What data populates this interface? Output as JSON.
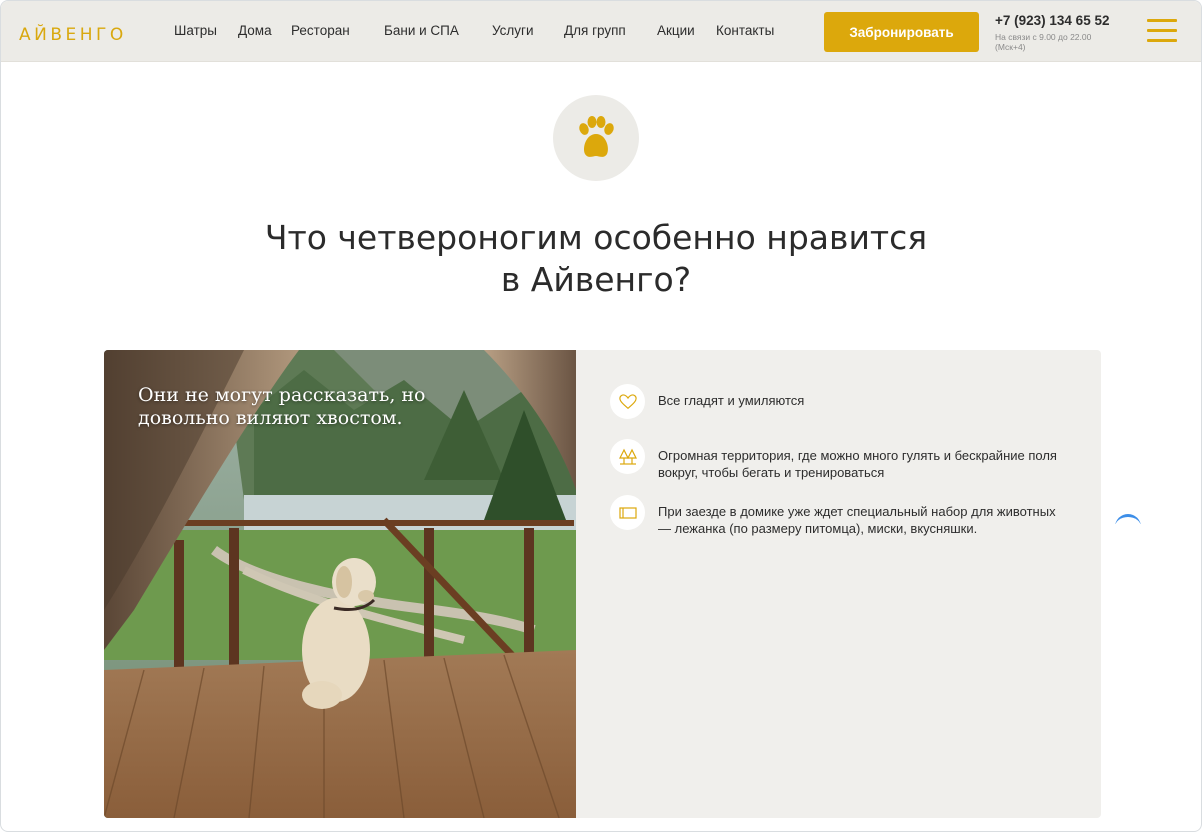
{
  "header": {
    "logo": "АЙВЕНГО",
    "nav": [
      {
        "label": "Шатры"
      },
      {
        "label": "Дома"
      },
      {
        "label": "Ресторан"
      },
      {
        "label": "Бани и СПА"
      },
      {
        "label": "Услуги"
      },
      {
        "label": "Для групп"
      },
      {
        "label": "Акции"
      },
      {
        "label": "Контакты"
      }
    ],
    "book_label": "Забронировать",
    "phone": "+7 (923) 134 65 52",
    "hours": "На связи с 9.00 до 22.00 (Мск+4)",
    "menu_icon": "hamburger-menu-icon"
  },
  "main": {
    "badge_icon": "paw-icon",
    "title": "Что четвероногим особенно нравится в Айвенго?",
    "photo_quote": "Они не могут рассказать, но довольно виляют хвостом.",
    "features": [
      {
        "icon": "heart-icon",
        "text": "Все гладят и умиляются"
      },
      {
        "icon": "trees-icon",
        "text": "Огромная территория, где можно много гулять и бескрайние поля вокруг, чтобы бегать и тренироваться"
      },
      {
        "icon": "bed-icon",
        "text": "При заезде в домике уже ждет специальный набор для животных — лежанка (по размеру питомца), миски, вкусняшки."
      }
    ]
  },
  "colors": {
    "accent": "#dca80c",
    "header_bg": "#ecebe7",
    "card_bg": "#f0efec"
  }
}
